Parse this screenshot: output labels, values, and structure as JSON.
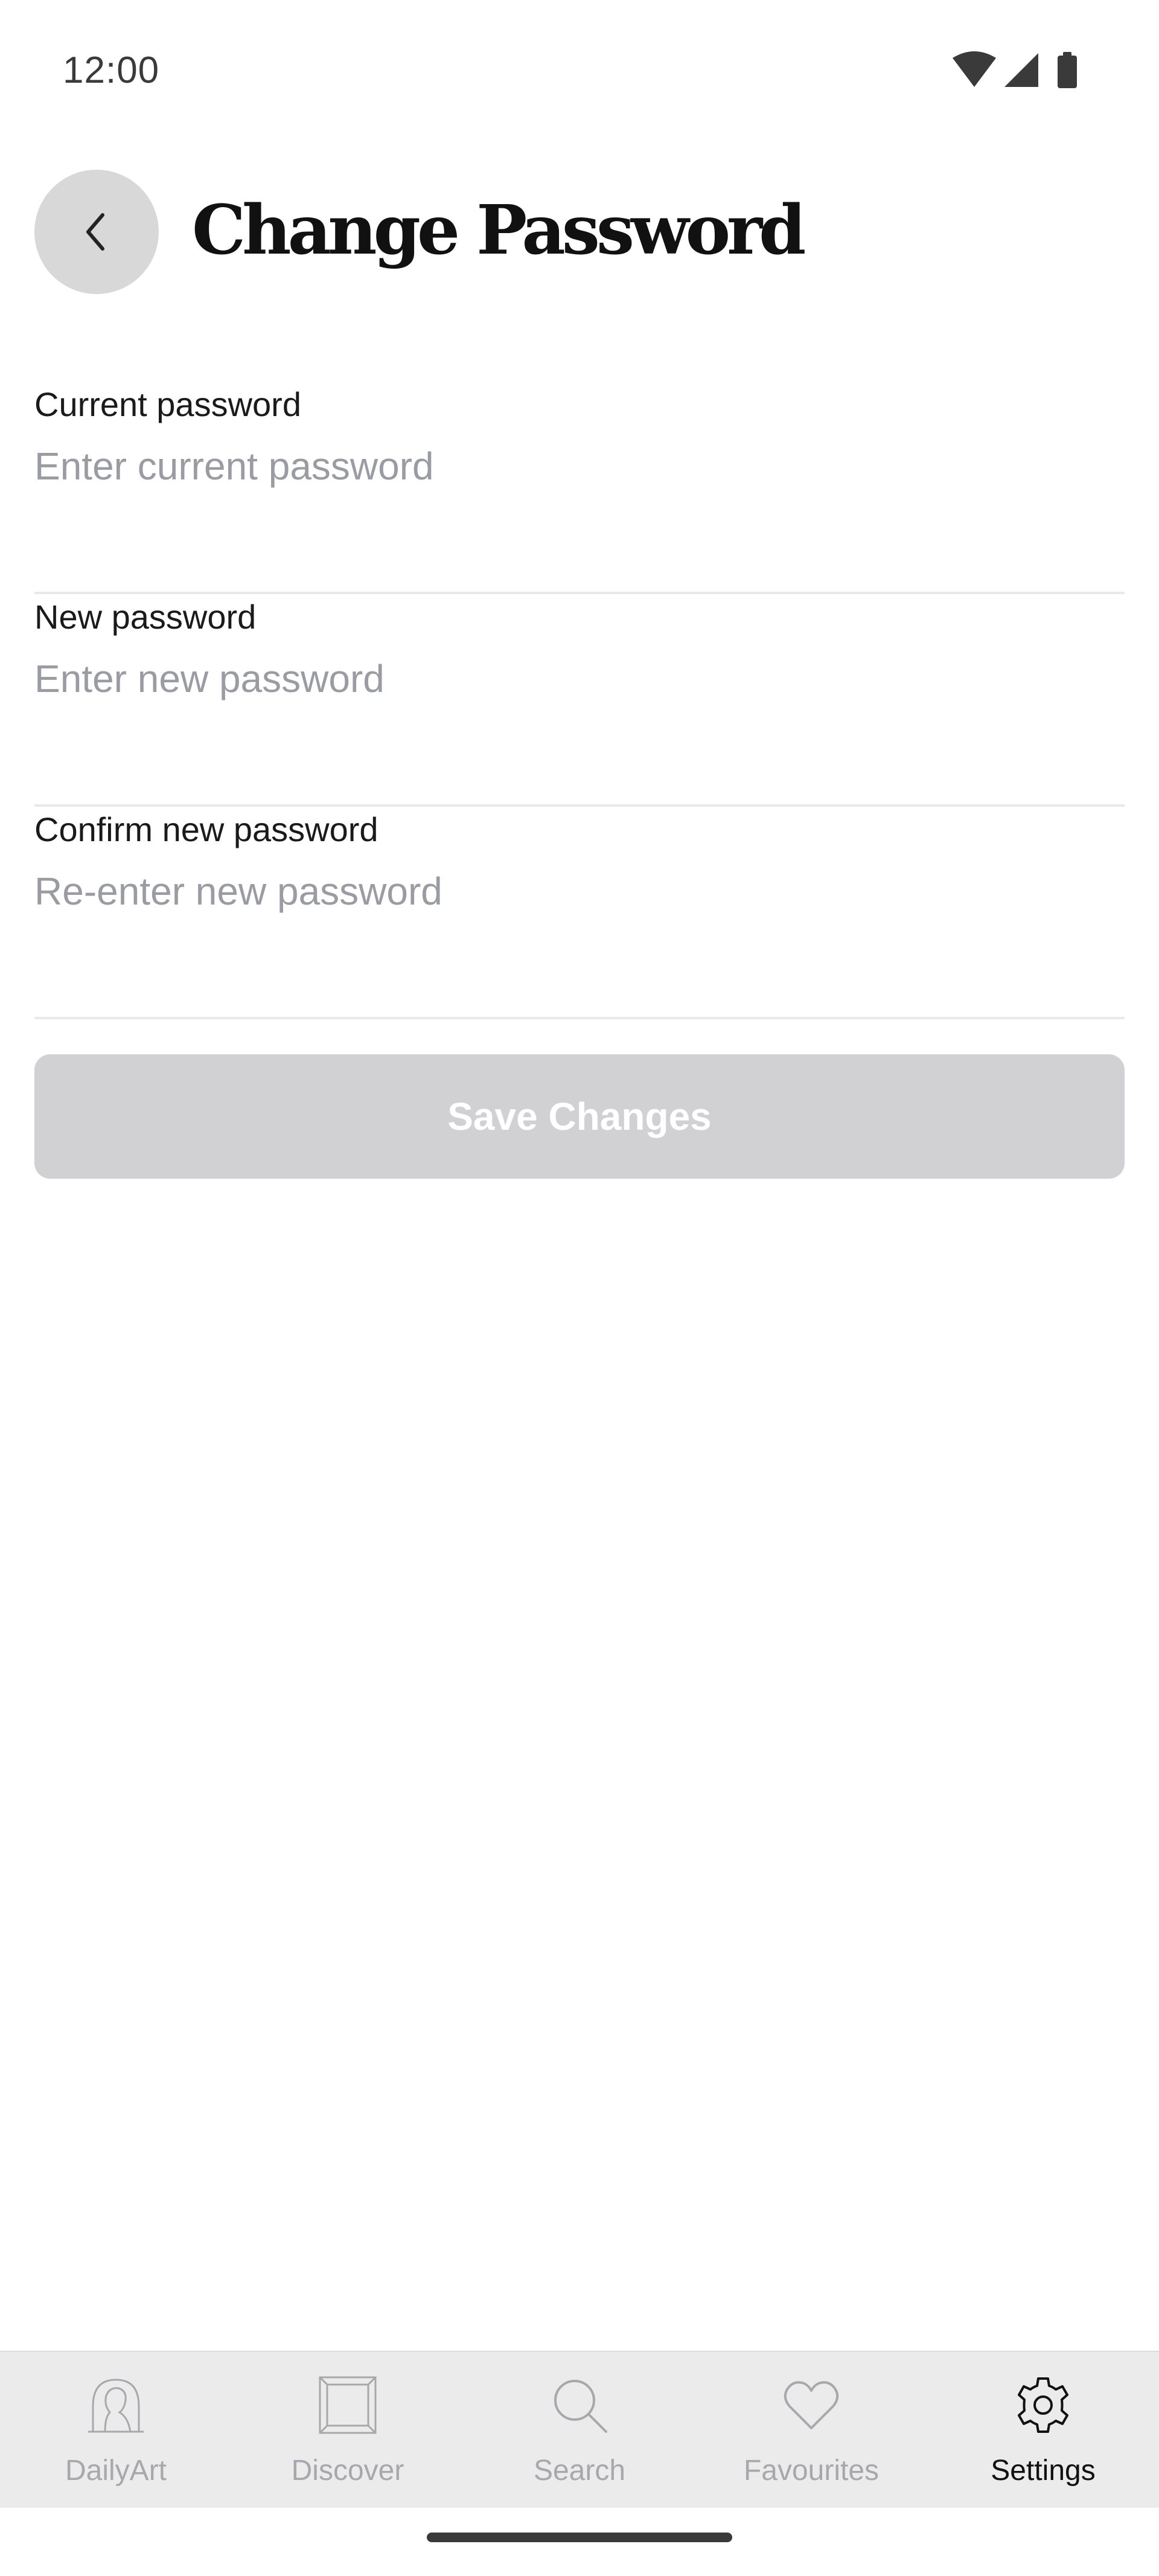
{
  "status_bar": {
    "time": "12:00",
    "icons": [
      "wifi-icon",
      "cellular-signal-icon",
      "battery-icon"
    ]
  },
  "header": {
    "back_icon": "chevron-left-icon",
    "title": "Change Password"
  },
  "form": {
    "current_password": {
      "label": "Current password",
      "placeholder": "Enter current password",
      "value": ""
    },
    "new_password": {
      "label": "New password",
      "placeholder": "Enter new password",
      "value": ""
    },
    "confirm_password": {
      "label": "Confirm new password",
      "placeholder": "Re-enter new password",
      "value": ""
    },
    "save_label": "Save Changes",
    "save_enabled": false
  },
  "bottom_nav": {
    "items": [
      {
        "label": "DailyArt",
        "icon": "portrait-icon",
        "active": false
      },
      {
        "label": "Discover",
        "icon": "frame-icon",
        "active": false
      },
      {
        "label": "Search",
        "icon": "search-icon",
        "active": false
      },
      {
        "label": "Favourites",
        "icon": "heart-icon",
        "active": false
      },
      {
        "label": "Settings",
        "icon": "gear-icon",
        "active": true
      }
    ]
  },
  "colors": {
    "background": "#ffffff",
    "back_button_bg": "#d8d8d8",
    "save_button_disabled_bg": "#d1d1d4",
    "placeholder_text": "#9a9ba3",
    "divider": "#e9e9e9",
    "nav_bg": "#ebebeb",
    "nav_inactive": "#a8a8ac",
    "nav_active": "#111111"
  }
}
